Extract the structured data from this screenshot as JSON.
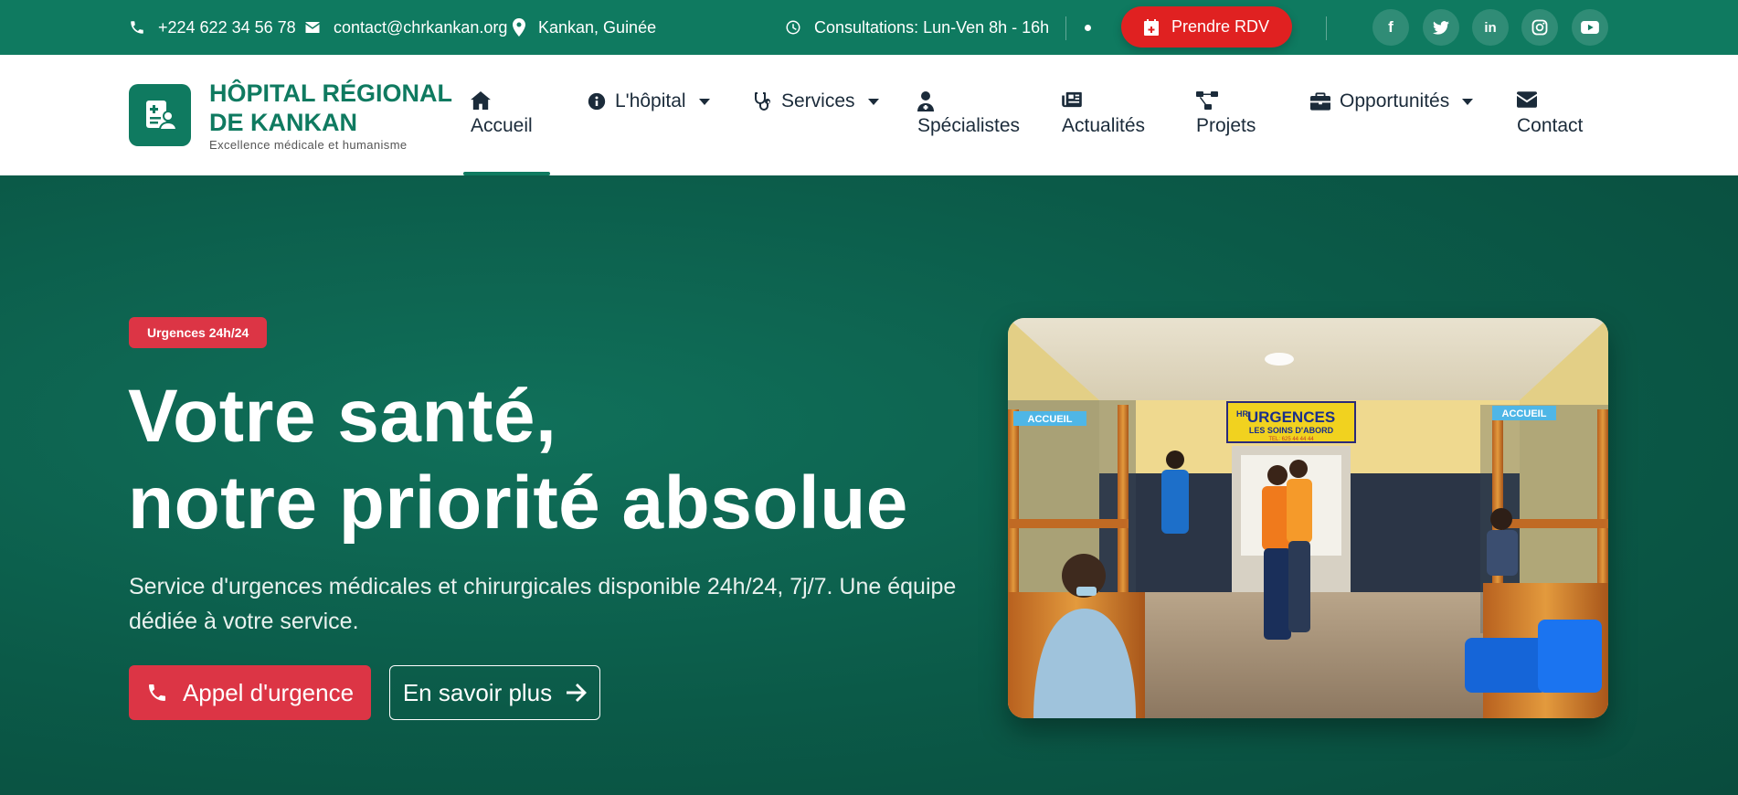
{
  "topbar": {
    "phone": "+224 622 34 56 78",
    "email": "contact@chrkankan.org",
    "location": "Kankan, Guinée",
    "hours": "Consultations: Lun-Ven 8h - 16h",
    "rdv_label": "Prendre RDV",
    "social": [
      "facebook-icon",
      "twitter-icon",
      "linkedin-icon",
      "instagram-icon",
      "youtube-icon"
    ]
  },
  "brand": {
    "line1": "HÔPITAL RÉGIONAL",
    "line2": "DE KANKAN",
    "tagline": "Excellence médicale et humanisme"
  },
  "nav": {
    "home": "Accueil",
    "hospital": "L'hôpital",
    "services": "Services",
    "specialists": "Spécialistes",
    "news": "Actualités",
    "projects": "Projets",
    "opportunities": "Opportunités",
    "contact": "Contact",
    "active": "Accueil"
  },
  "hero": {
    "badge": "Urgences 24h/24",
    "title_line1": "Votre santé,",
    "title_line2": "notre priorité absolue",
    "lead": "Service d'urgences médicales et chirurgicales disponible 24h/24, 7j/7. Une équipe dédiée à votre service.",
    "primary_btn": "Appel d'urgence",
    "secondary_btn": "En savoir plus"
  },
  "photo": {
    "sign_main": "URGENCES",
    "sign_sub": "LES SOINS D'ABORD",
    "sign_tel": "TEL: 625 44 44 44",
    "left_label": "ACCUEIL",
    "right_label": "ACCUEIL",
    "mini_logo": "HR"
  },
  "colors": {
    "primary": "#0f7a60",
    "danger": "#dc3545",
    "rdv": "#e02121"
  }
}
